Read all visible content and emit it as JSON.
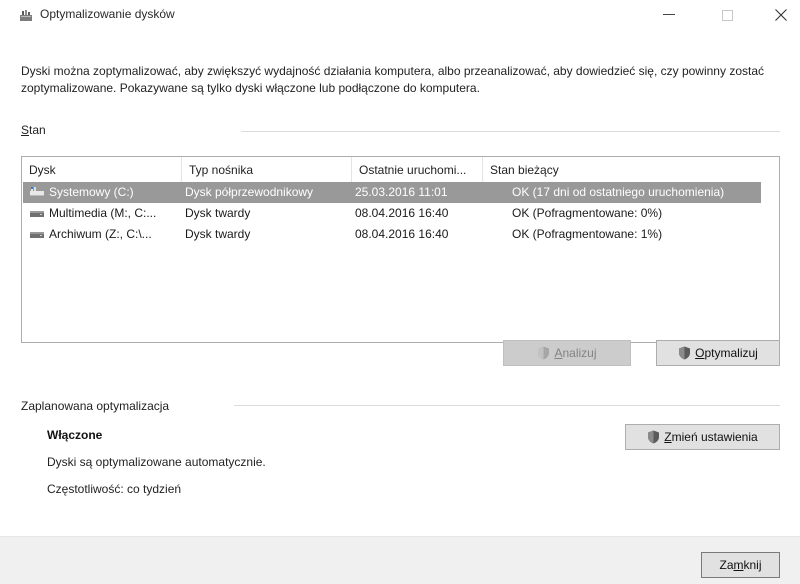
{
  "window": {
    "title": "Optymalizowanie dysków",
    "minimize_glyph": "—",
    "close_glyph": "✕"
  },
  "description": "Dyski można zoptymalizować, aby zwiększyć wydajność działania komputera, albo przeanalizować, aby dowiedzieć się, czy powinny zostać zoptymalizowane. Pokazywane są tylko dyski włączone lub podłączone do komputera.",
  "status": {
    "section_label_accel": "S",
    "section_label_rest": "tan"
  },
  "table": {
    "columns": [
      "Dysk",
      "Typ nośnika",
      "Ostatnie uruchomi...",
      "Stan bieżący"
    ],
    "rows": [
      {
        "icon": "ssd-drive-icon",
        "drive": "Systemowy (C:)",
        "media": "Dysk półprzewodnikowy",
        "last_run": "25.03.2016 11:01",
        "status": "OK (17 dni od ostatniego uruchomienia)",
        "selected": true
      },
      {
        "icon": "hdd-drive-icon",
        "drive": "Multimedia (M:, C:...",
        "media": "Dysk twardy",
        "last_run": "08.04.2016 16:40",
        "status": "OK (Pofragmentowane: 0%)",
        "selected": false
      },
      {
        "icon": "hdd-drive-icon",
        "drive": "Archiwum (Z:, C:\\...",
        "media": "Dysk twardy",
        "last_run": "08.04.2016 16:40",
        "status": "OK (Pofragmentowane: 1%)",
        "selected": false
      }
    ]
  },
  "buttons": {
    "analyze_accel": "A",
    "analyze_rest": "nalizuj",
    "optimize_accel": "O",
    "optimize_rest": "ptymalizuj",
    "change_accel": "Z",
    "change_rest": "mień ustawienia",
    "close_pre": "Za",
    "close_accel": "m",
    "close_rest": "knij"
  },
  "schedule": {
    "section_label": "Zaplanowana optymalizacja",
    "state": "Włączone",
    "auto_text": "Dyski są optymalizowane automatycznie.",
    "frequency_text": "Częstotliwość: co tydzień"
  }
}
